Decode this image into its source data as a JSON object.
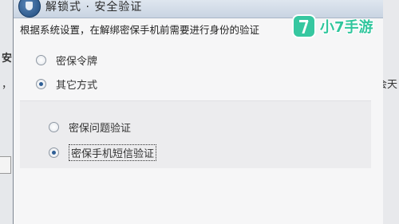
{
  "dialog": {
    "title": "解锁式 · 安全验证",
    "description": "根据系统设置，在解绑密保手机前需要进行身份的验证",
    "options": [
      {
        "label": "密保令牌",
        "checked": false
      },
      {
        "label": "其它方式",
        "checked": true
      }
    ],
    "sub_options": [
      {
        "label": "密保问题验证",
        "checked": false
      },
      {
        "label": "密保手机短信验证",
        "checked": true
      }
    ]
  },
  "background": {
    "frag_a": "安",
    "frag_b": "，",
    "frag_c": "会天"
  },
  "watermark": {
    "text": "小7手游",
    "color": "#30c69d"
  }
}
